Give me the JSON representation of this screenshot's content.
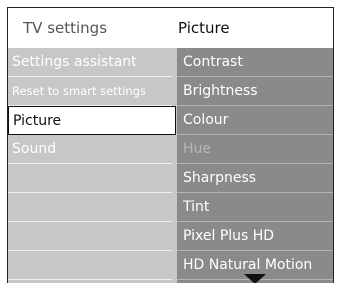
{
  "header": {
    "left_title": "TV settings",
    "right_title": "Picture"
  },
  "left_menu": [
    {
      "label": "Settings assistant"
    },
    {
      "label": "Reset to smart settings"
    },
    {
      "label": "Picture"
    },
    {
      "label": "Sound"
    }
  ],
  "right_menu": [
    {
      "label": "Contrast"
    },
    {
      "label": "Brightness"
    },
    {
      "label": "Colour"
    },
    {
      "label": "Hue"
    },
    {
      "label": "Sharpness"
    },
    {
      "label": "Tint"
    },
    {
      "label": "Pixel Plus HD"
    },
    {
      "label": "HD Natural Motion"
    }
  ],
  "colors": {
    "left_panel": "#c7c7c7",
    "right_panel": "#8a8a8a",
    "selected_bg": "#ffffff",
    "disabled_text": "#b6b6b6"
  },
  "icons": {
    "scroll": "scroll-down-arrow-icon"
  }
}
